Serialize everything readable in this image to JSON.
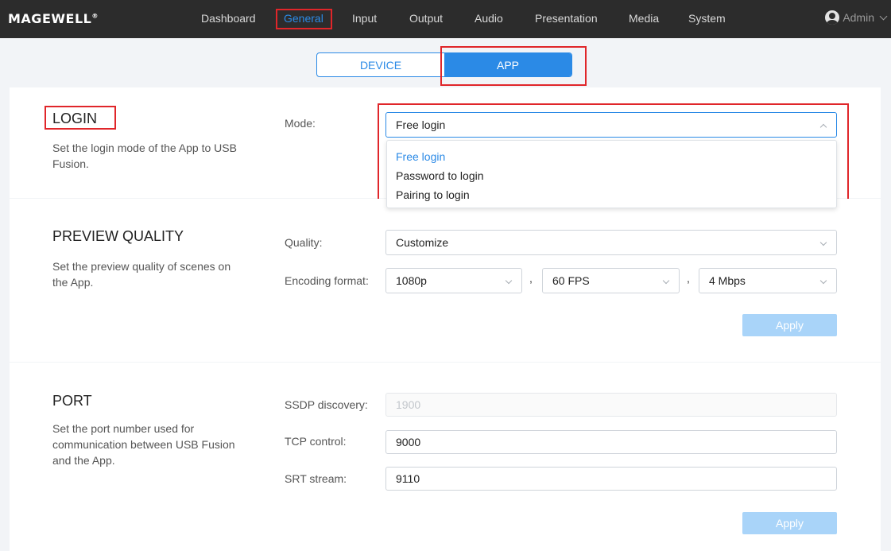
{
  "header": {
    "logo": "MAGEWELL",
    "logo_mark": "®",
    "nav": [
      {
        "label": "Dashboard"
      },
      {
        "label": "General"
      },
      {
        "label": "Input"
      },
      {
        "label": "Output"
      },
      {
        "label": "Audio"
      },
      {
        "label": "Presentation"
      },
      {
        "label": "Media"
      },
      {
        "label": "System"
      }
    ],
    "active_nav": "General",
    "user": "Admin"
  },
  "tabs": [
    {
      "label": "DEVICE"
    },
    {
      "label": "APP"
    }
  ],
  "active_tab": "APP",
  "login": {
    "title": "LOGIN",
    "description": "Set the login mode of the App to USB Fusion.",
    "mode_label": "Mode:",
    "mode_value": "Free login",
    "options": [
      "Free login",
      "Password to login",
      "Pairing to login"
    ],
    "selected_option": "Free login"
  },
  "preview": {
    "title": "PREVIEW QUALITY",
    "description": "Set the preview quality of scenes on the App.",
    "quality_label": "Quality:",
    "quality_value": "Customize",
    "encoding_label": "Encoding format:",
    "resolution": "1080p",
    "separator": ",",
    "fps": "60 FPS",
    "bitrate": "4 Mbps",
    "apply": "Apply"
  },
  "port": {
    "title": "PORT",
    "description": "Set the port number used for communication between USB Fusion and the App.",
    "ssdp_label": "SSDP discovery:",
    "ssdp_value": "1900",
    "tcp_label": "TCP control:",
    "tcp_value": "9000",
    "srt_label": "SRT stream:",
    "srt_value": "9110",
    "apply": "Apply"
  },
  "colors": {
    "accent": "#2b8ae6",
    "topbar": "#2c2c2c",
    "highlight": "#e0262a",
    "button_disabled": "#a9d4f9"
  }
}
